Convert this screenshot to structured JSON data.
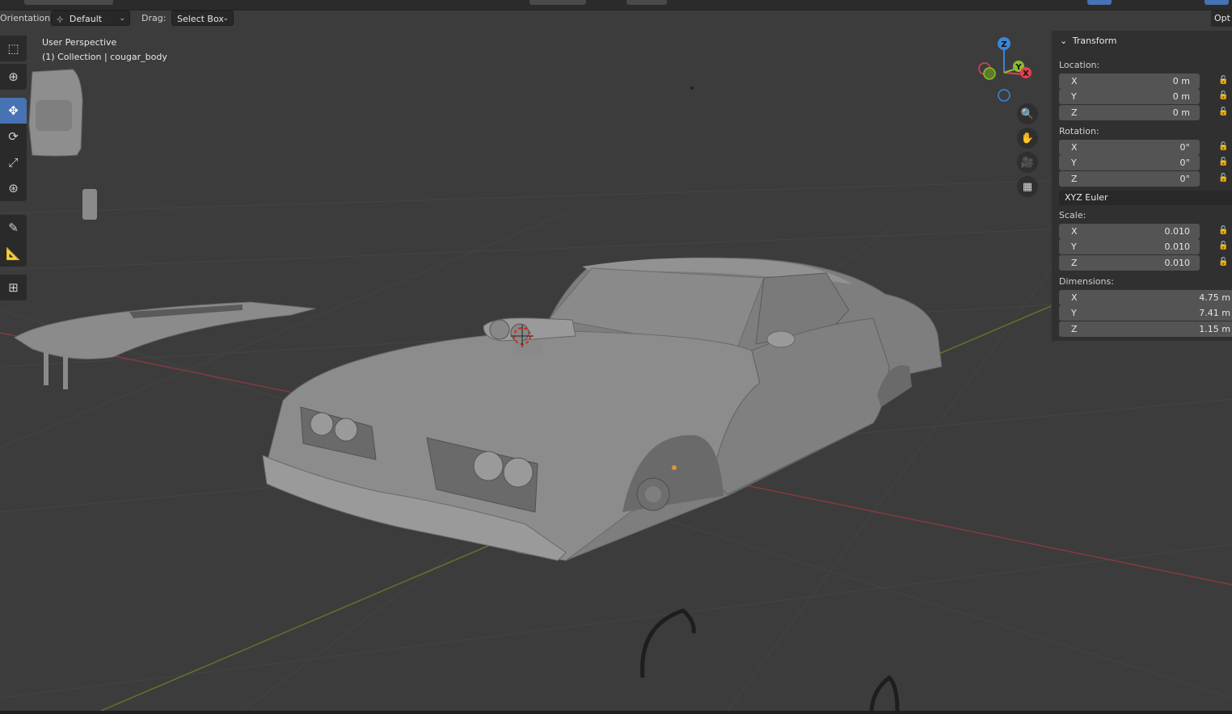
{
  "header": {
    "orientation_label": "Orientation:",
    "orientation_value": "Default",
    "drag_label": "Drag:",
    "drag_value": "Select Box",
    "options_label": "Opt"
  },
  "viewport": {
    "view_name": "User Perspective",
    "collection_line": "(1) Collection | cougar_body"
  },
  "toolbar": {
    "tools": [
      "select-box",
      "cursor",
      "move",
      "rotate",
      "scale",
      "transform",
      "annotate",
      "measure",
      "add-cube"
    ],
    "active": "move"
  },
  "gizmo": {
    "z": "Z",
    "y": "Y",
    "x": "X",
    "colors": {
      "x": "#e4404e",
      "y": "#8cbd2c",
      "z": "#3b86d6"
    }
  },
  "npanel": {
    "title": "Transform",
    "location_label": "Location:",
    "location": [
      {
        "axis": "X",
        "value": "0 m"
      },
      {
        "axis": "Y",
        "value": "0 m"
      },
      {
        "axis": "Z",
        "value": "0 m"
      }
    ],
    "rotation_label": "Rotation:",
    "rotation": [
      {
        "axis": "X",
        "value": "0°"
      },
      {
        "axis": "Y",
        "value": "0°"
      },
      {
        "axis": "Z",
        "value": "0°"
      }
    ],
    "rotation_mode": "XYZ Euler",
    "scale_label": "Scale:",
    "scale": [
      {
        "axis": "X",
        "value": "0.010"
      },
      {
        "axis": "Y",
        "value": "0.010"
      },
      {
        "axis": "Z",
        "value": "0.010"
      }
    ],
    "dimensions_label": "Dimensions:",
    "dimensions": [
      {
        "axis": "X",
        "value": "4.75 m"
      },
      {
        "axis": "Y",
        "value": "7.41 m"
      },
      {
        "axis": "Z",
        "value": "1.15 m"
      }
    ]
  }
}
